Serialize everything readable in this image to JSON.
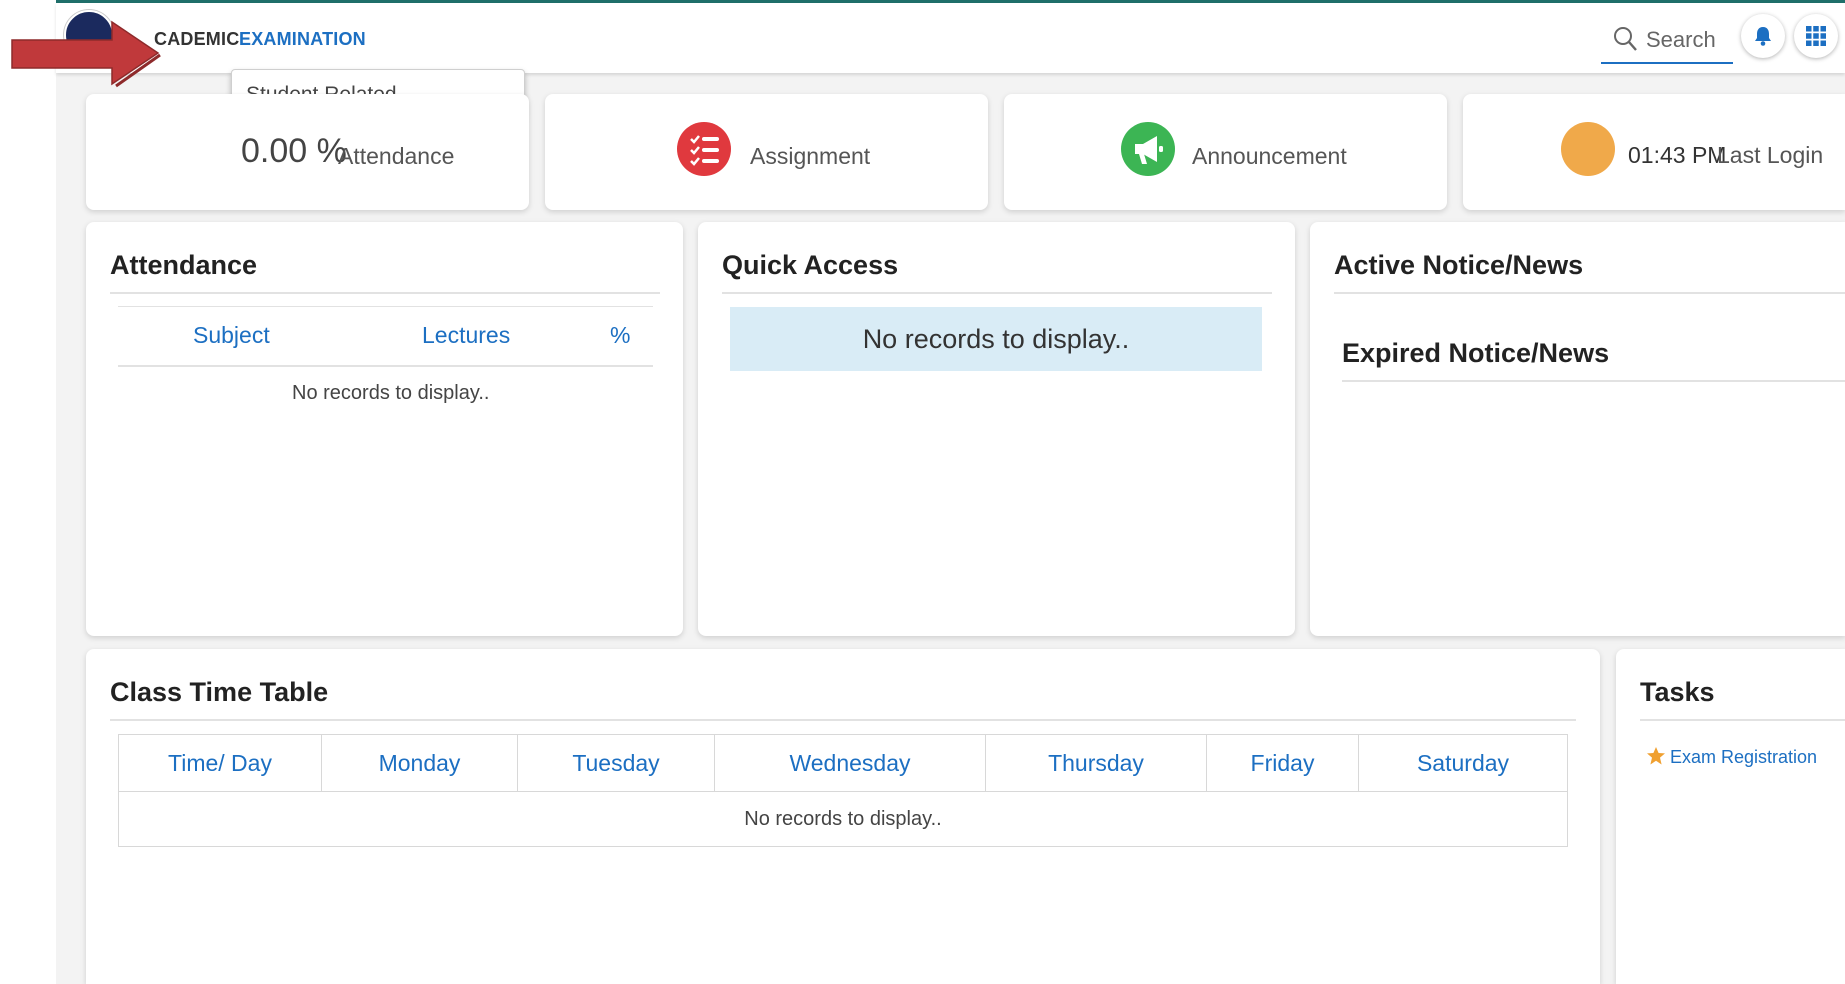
{
  "nav": {
    "menu_academic": "CADEMIC",
    "menu_examination": "EXAMINATION",
    "dropdown_item": "Student Related"
  },
  "header": {
    "search_label": "Search",
    "bell_icon": "bell-icon",
    "apps_icon": "grid-icon"
  },
  "stats": {
    "attendance_value": "0.00 %",
    "attendance_label": "Attendance",
    "assignment_label": "Assignment",
    "announcement_label": "Announcement",
    "last_login_value": "01:43 PM",
    "last_login_label": "Last Login"
  },
  "attendance_panel": {
    "title": "Attendance",
    "columns": [
      "Subject",
      "Lectures",
      "%"
    ],
    "empty_text": "No records to display.."
  },
  "quick_access": {
    "title": "Quick Access",
    "empty_text": "No records to display.."
  },
  "news": {
    "active_title": "Active Notice/News",
    "expired_title": "Expired Notice/News"
  },
  "timetable": {
    "title": "Class Time Table",
    "columns": [
      "Time/ Day",
      "Monday",
      "Tuesday",
      "Wednesday",
      "Thursday",
      "Friday",
      "Saturday"
    ],
    "empty_text": "No records to display.."
  },
  "tasks": {
    "title": "Tasks",
    "items": [
      {
        "label": "Exam Registration",
        "icon": "star-icon"
      }
    ]
  },
  "colors": {
    "accent_blue": "#1c6fc2",
    "assignment_red": "#e0393e",
    "announcement_green": "#3cb554",
    "login_orange": "#f0a94a",
    "annotation_arrow": "#c0393b"
  }
}
